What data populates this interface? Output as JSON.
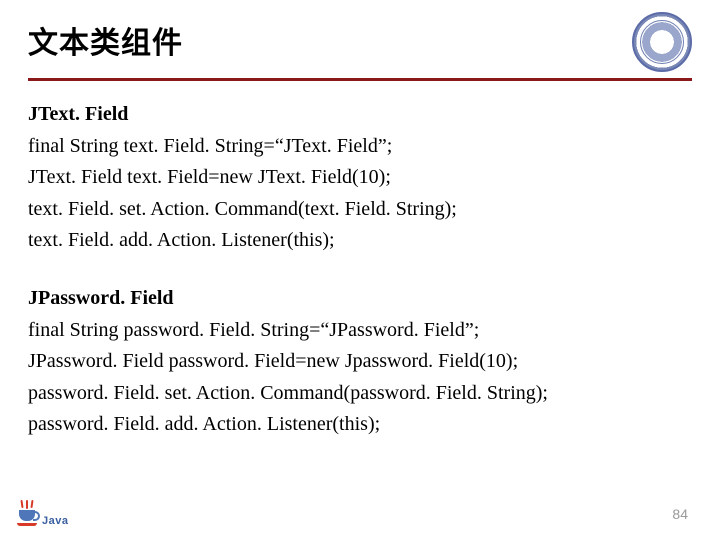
{
  "header": {
    "title": "文本类组件"
  },
  "section1": {
    "heading": "JText. Field",
    "lines": [
      "final String text. Field. String=“JText. Field”;",
      "JText. Field text. Field=new JText. Field(10);",
      "text. Field. set. Action. Command(text. Field. String);",
      "text. Field. add. Action. Listener(this);"
    ]
  },
  "section2": {
    "heading": "JPassword. Field",
    "lines": [
      "final String password. Field. String=“JPassword. Field”;",
      "JPassword. Field password. Field=new Jpassword. Field(10);",
      "password. Field. set. Action. Command(password. Field. String);",
      "password. Field. add. Action. Listener(this);"
    ]
  },
  "footer": {
    "logo_text": "Java",
    "page_number": "84"
  }
}
